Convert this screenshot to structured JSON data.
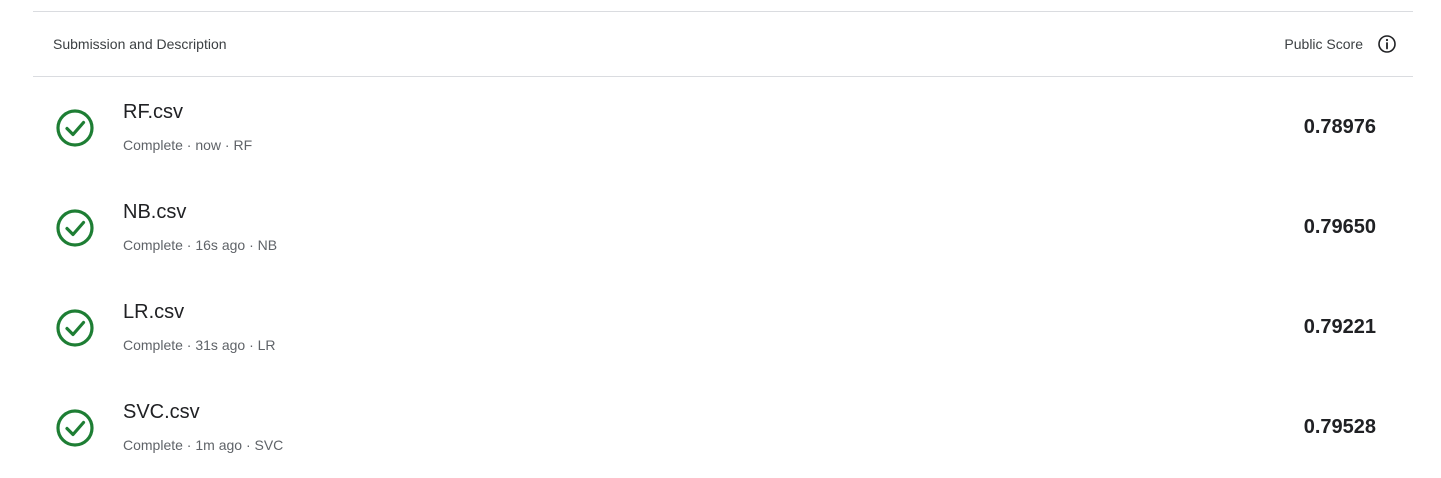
{
  "header": {
    "left_label": "Submission and Description",
    "score_label": "Public Score",
    "info_icon": "info-icon"
  },
  "colors": {
    "success": "#1e7e34",
    "divider": "#dadce0",
    "text_primary": "#202124",
    "text_secondary": "#5f6368"
  },
  "submissions": [
    {
      "file": "RF.csv",
      "status": "Complete",
      "time": "now",
      "description": "RF",
      "meta": "Complete · now · RF",
      "score": "0.78976",
      "icon": "check-circle-icon"
    },
    {
      "file": "NB.csv",
      "status": "Complete",
      "time": "16s ago",
      "description": "NB",
      "meta": "Complete · 16s ago · NB",
      "score": "0.79650",
      "icon": "check-circle-icon"
    },
    {
      "file": "LR.csv",
      "status": "Complete",
      "time": "31s ago",
      "description": "LR",
      "meta": "Complete · 31s ago · LR",
      "score": "0.79221",
      "icon": "check-circle-icon"
    },
    {
      "file": "SVC.csv",
      "status": "Complete",
      "time": "1m ago",
      "description": "SVC",
      "meta": "Complete · 1m ago · SVC",
      "score": "0.79528",
      "icon": "check-circle-icon"
    }
  ]
}
